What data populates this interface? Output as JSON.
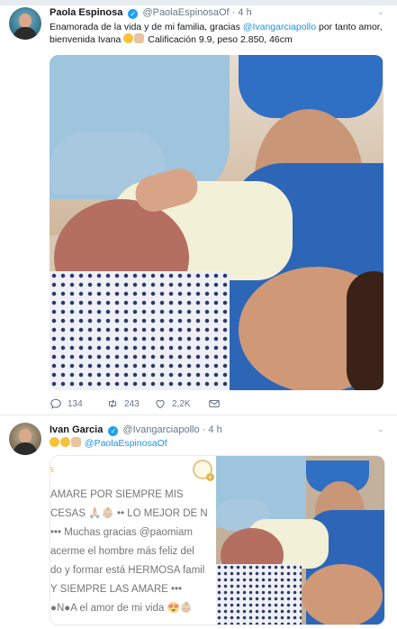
{
  "tweets": [
    {
      "name": "Paola Espinosa",
      "handle": "@PaolaEspinosaOf",
      "sep": "·",
      "time": "4 h",
      "text_start": "Enamorada de la vida y de mi familia, gracias ",
      "mention": "@Ivangarciapollo",
      "text_mid": " por tanto amor,",
      "text_line2": "bienvenida Ivana",
      "text_end": " Calificación 9.9, peso 2.850, 46cm",
      "actions": {
        "replies": "134",
        "retweets": "243",
        "likes": "2,2K"
      }
    },
    {
      "name": "Ivan Garcia",
      "handle": "@Ivangarciapollo",
      "sep": "·",
      "time": "4 h",
      "mention": "@PaolaEspinosaOf",
      "image_text": {
        "l0": "as",
        "l1": "AMARE POR SIEMPRE MIS",
        "l2": "CESAS 🙏🏼👶🏼 •• LO MEJOR DE N",
        "l3": "••• Muchas gracias @paomiam",
        "l4": "acerme el hombre más feliz del",
        "l5": "do y formar está HERMOSA famil",
        "l6": "Y SIEMPRE LAS AMARE •••",
        "l7": "●N●A el amor de mi vida 😍👶🏼"
      }
    }
  ],
  "icons": {
    "verified": "verified-badge-icon",
    "chevron": "chevron-down-icon",
    "reply": "reply-icon",
    "retweet": "retweet-icon",
    "like": "heart-icon",
    "dm": "envelope-icon"
  },
  "colors": {
    "link": "#1b95e0",
    "verified": "#1da1f2",
    "meta": "#657786"
  },
  "glyphs": {
    "verified_check": "✓",
    "chevron": "⌄"
  }
}
